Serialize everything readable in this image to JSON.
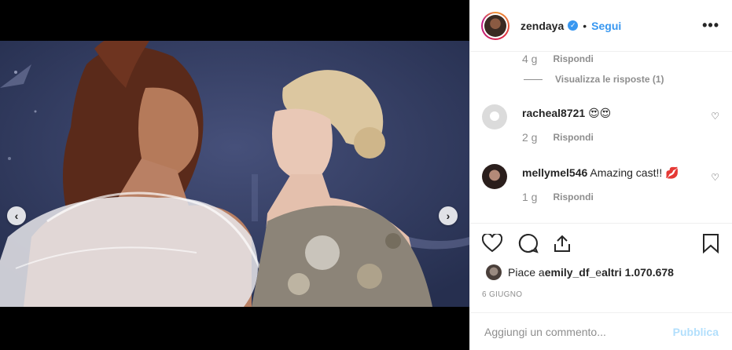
{
  "post": {
    "username": "zendaya",
    "verified_icon": "verified-badge-icon",
    "separator": "•",
    "follow_label": "Segui",
    "more_label": "•••"
  },
  "media": {
    "prev_label": "‹",
    "next_label": "›"
  },
  "comments": {
    "first_meta": {
      "time": "4 g",
      "reply": "Rispondi"
    },
    "view_replies": "Visualizza le risposte (1)",
    "items": [
      {
        "username": "racheal8721",
        "text": "😍😍",
        "time": "2 g",
        "reply": "Rispondi"
      },
      {
        "username": "mellymel546",
        "text": "Amazing cast!! 💋",
        "time": "1 g",
        "reply": "Rispondi"
      }
    ]
  },
  "likes": {
    "prefix": "Piace a ",
    "user": "emily_df_",
    "middle": " e ",
    "others": "altri 1.070.678"
  },
  "date": "6 GIUGNO",
  "composer": {
    "placeholder": "Aggiungi un commento...",
    "publish_label": "Pubblica"
  },
  "colors": {
    "accent": "#3897f0",
    "publish_disabled": "#b2dffc",
    "meta_gray": "#8e8e8e"
  }
}
